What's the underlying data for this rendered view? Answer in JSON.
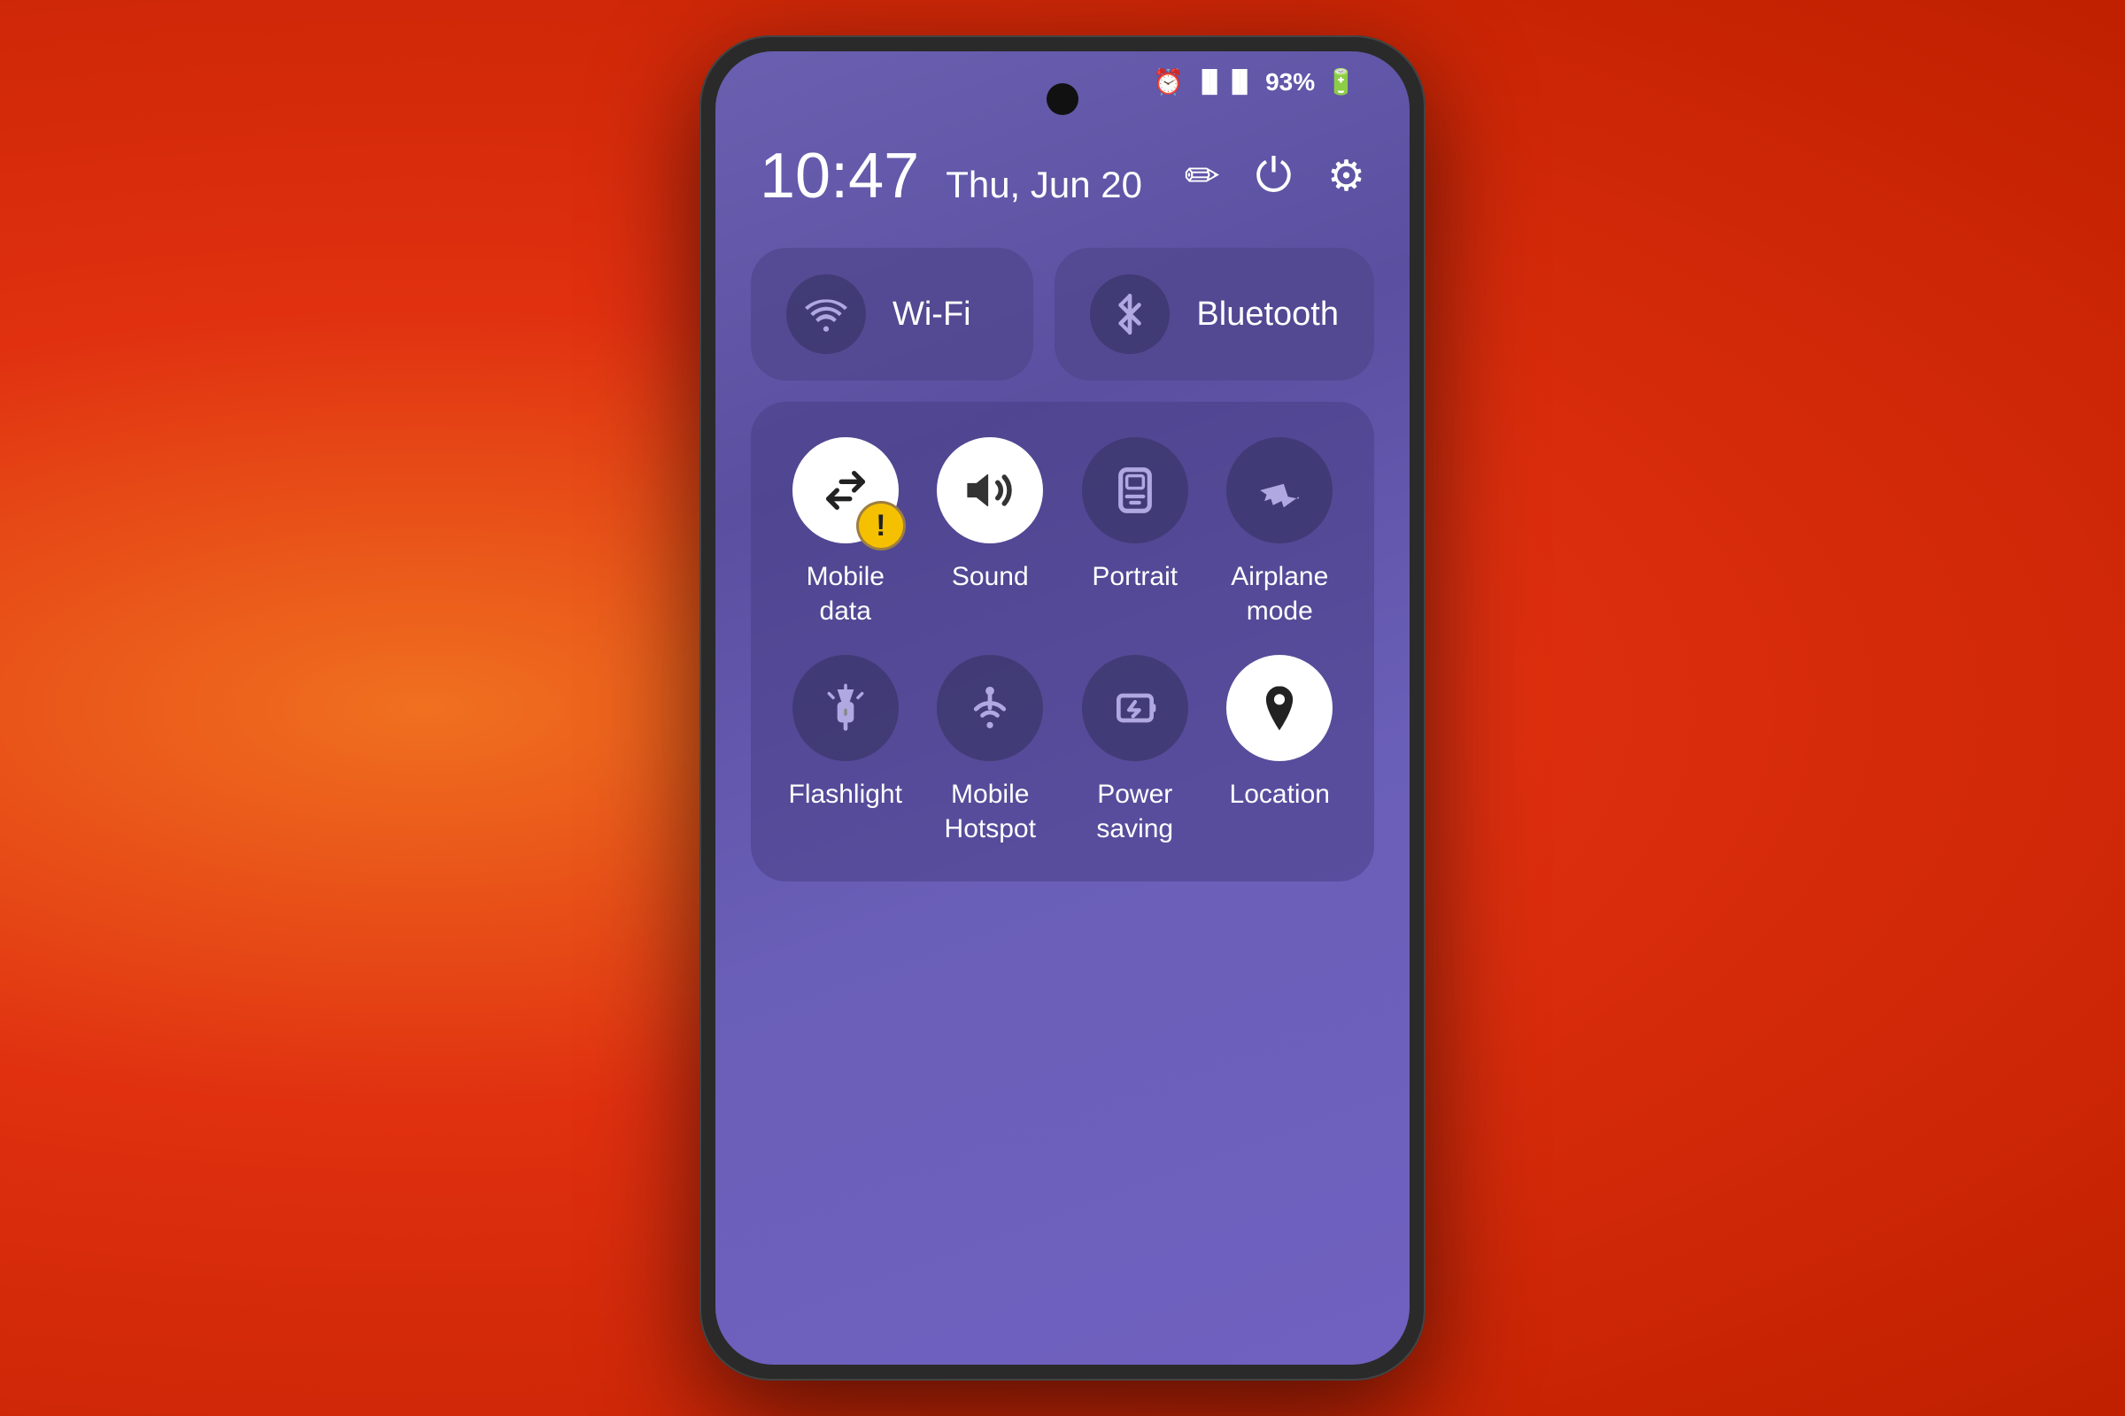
{
  "background": {
    "color": "#e84020"
  },
  "phone": {
    "status_bar": {
      "alarm_icon": "⏰",
      "signal_icon": "📶",
      "battery_percent": "93%",
      "battery_icon": "🔋"
    },
    "time": "10:47",
    "date": "Thu, Jun 20",
    "header_icons": {
      "edit": "✏️",
      "power": "⏻",
      "settings": "⚙"
    },
    "top_tiles": [
      {
        "id": "wifi",
        "label": "Wi-Fi",
        "icon": "wifi"
      },
      {
        "id": "bluetooth",
        "label": "Bluetooth",
        "icon": "bluetooth"
      }
    ],
    "grid_row1": [
      {
        "id": "mobile-data",
        "label": "Mobile\ndata",
        "icon": "mobile-data",
        "active": true,
        "warning": true
      },
      {
        "id": "sound",
        "label": "Sound",
        "icon": "sound",
        "active": true
      },
      {
        "id": "portrait",
        "label": "Portrait",
        "icon": "portrait",
        "active": false
      },
      {
        "id": "airplane",
        "label": "Airplane\nmode",
        "icon": "airplane",
        "active": false
      }
    ],
    "grid_row2": [
      {
        "id": "flashlight",
        "label": "Flashlight",
        "icon": "flashlight",
        "active": false
      },
      {
        "id": "mobile-hotspot",
        "label": "Mobile\nHotspot",
        "icon": "hotspot",
        "active": false
      },
      {
        "id": "power-saving",
        "label": "Power\nsaving",
        "icon": "power-saving",
        "active": false
      },
      {
        "id": "location",
        "label": "Location",
        "icon": "location",
        "active": true
      }
    ]
  }
}
